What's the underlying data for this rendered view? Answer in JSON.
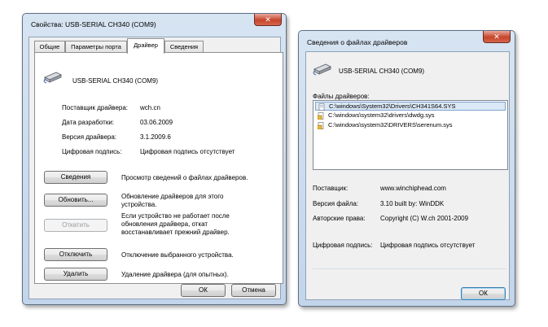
{
  "props": {
    "title": "Свойства: USB-SERIAL CH340 (COM9)",
    "close_glyph": "✕",
    "tabs": [
      {
        "label": "Общие"
      },
      {
        "label": "Параметры порта"
      },
      {
        "label": "Драйвер"
      },
      {
        "label": "Сведения"
      }
    ],
    "active_tab": "Драйвер",
    "device_name": "USB-SERIAL CH340 (COM9)",
    "fields": [
      {
        "label": "Поставщик драйвера:",
        "value": "wch.cn"
      },
      {
        "label": "Дата разработки:",
        "value": "03.06.2009"
      },
      {
        "label": "Версия драйвера:",
        "value": "3.1.2009.6"
      },
      {
        "label": "Цифровая подпись:",
        "value": "Цифровая подпись отсутствует"
      }
    ],
    "actions": [
      {
        "button": "Сведения",
        "desc": "Просмотр сведений о файлах драйверов.",
        "enabled": true
      },
      {
        "button": "Обновить...",
        "desc": "Обновление драйверов для этого устройства.",
        "enabled": true
      },
      {
        "button": "Откатить",
        "desc": "Если устройство не работает после обновления драйвера, откат восстанавливает прежний драйвер.",
        "enabled": false
      },
      {
        "button": "Отключить",
        "desc": "Отключение выбранного устройства.",
        "enabled": true
      },
      {
        "button": "Удалить",
        "desc": "Удаление драйвера (для опытных).",
        "enabled": true
      }
    ],
    "ok_label": "ОК",
    "cancel_label": "Отмена"
  },
  "details": {
    "title": "Сведения о файлах драйверов",
    "close_glyph": "✕",
    "device_name": "USB-SERIAL CH340 (COM9)",
    "files_label": "Файлы драйверов:",
    "files": [
      {
        "path": "C:\\windows\\System32\\Drivers\\CH341S64.SYS",
        "signed": true,
        "selected": true
      },
      {
        "path": "C:\\windows\\system32\\drivers\\dwdg.sys",
        "signed": false,
        "selected": false
      },
      {
        "path": "C:\\windows\\system32\\DRIVERS\\serenum.sys",
        "signed": false,
        "selected": false
      }
    ],
    "fields": [
      {
        "label": "Поставщик:",
        "value": "www.winchiphead.com"
      },
      {
        "label": "Версия файла:",
        "value": "3.10 built by: WinDDK"
      },
      {
        "label": "Авторские права:",
        "value": "Copyright (C) W.ch 2001-2009"
      }
    ],
    "signature": {
      "label": "Цифровая подпись:",
      "value": "Цифровая подпись отсутствует"
    },
    "ok_label": "ОК"
  },
  "icons": {
    "device": "usb-serial-device-icon",
    "file": "driver-file-icon",
    "file_warning": "unsigned-driver-file-icon"
  },
  "colors": {
    "frame": "#c3d5ea",
    "close_button": "#c7452b",
    "selection": "#dbe8f6"
  }
}
